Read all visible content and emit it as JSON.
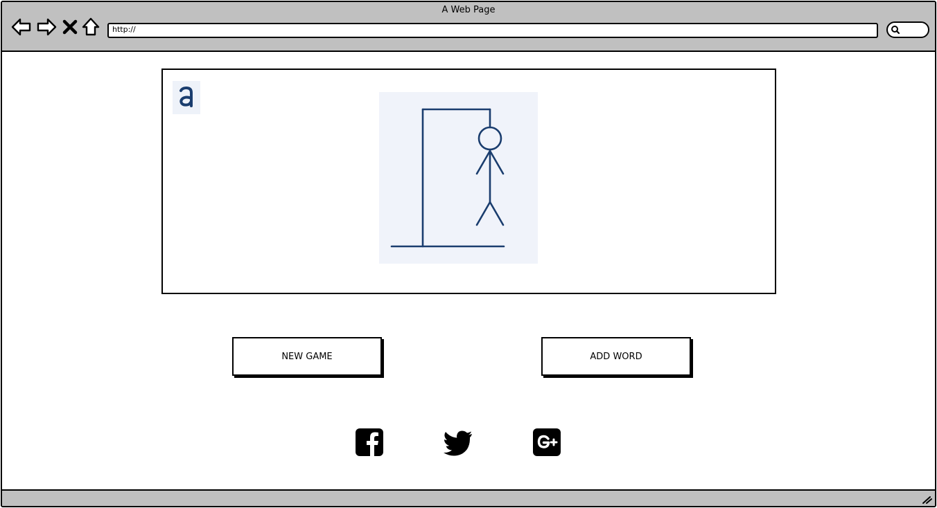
{
  "window": {
    "title": "A Web Page"
  },
  "toolbar": {
    "back_icon": "arrow-left-icon",
    "forward_icon": "arrow-right-icon",
    "stop_icon": "close-icon",
    "home_icon": "home-icon",
    "address_value": "http://",
    "search_icon": "search-icon"
  },
  "game": {
    "logo_icon": "hangman-logo-icon",
    "illustration": "hangman-gallows-figure"
  },
  "actions": {
    "new_game_label": "NEW GAME",
    "add_word_label": "ADD WORD"
  },
  "social": {
    "items": [
      {
        "icon": "facebook-icon"
      },
      {
        "icon": "twitter-icon"
      },
      {
        "icon": "google-plus-icon"
      }
    ]
  },
  "colors": {
    "chrome": "#c0c0c0",
    "figure_stroke": "#1a3d6e",
    "illustration_bg": "#f0f3fa"
  }
}
